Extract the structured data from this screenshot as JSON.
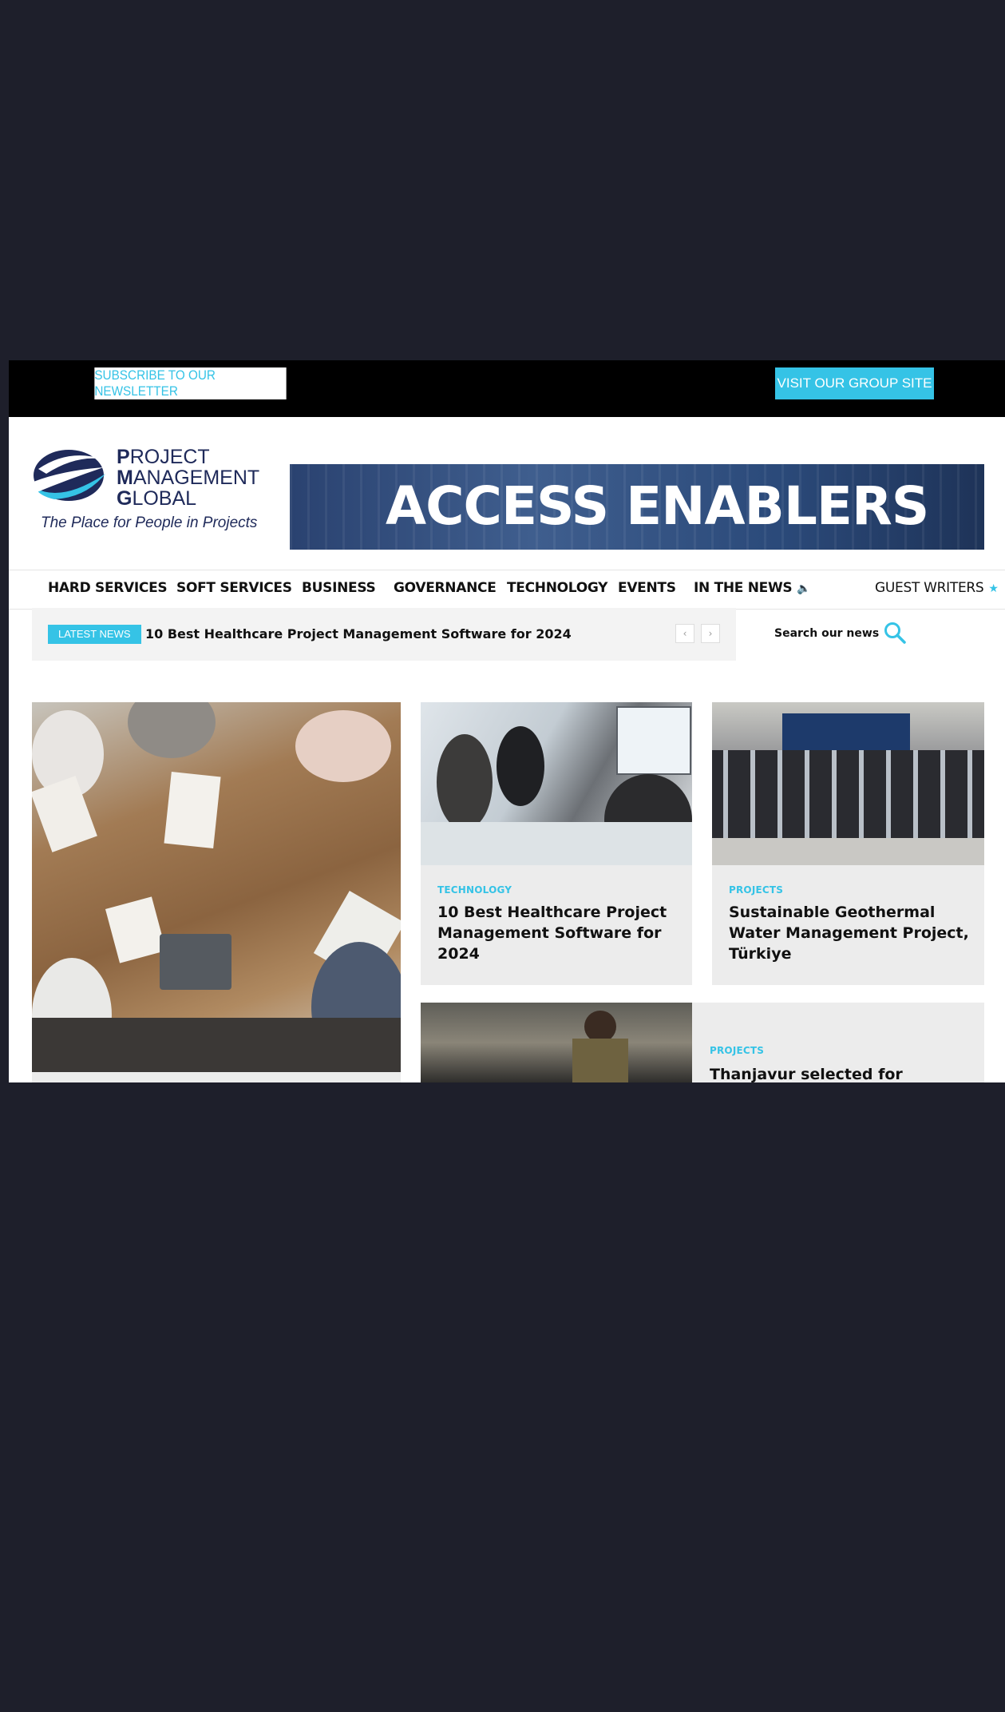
{
  "topbar": {
    "newsletter_label": "SUBSCRIBE TO OUR NEWSLETTER",
    "group_site_label": "VISIT OUR GROUP SITE"
  },
  "header": {
    "logo_line1_initial": "P",
    "logo_line1_rest": "ROJECT",
    "logo_line2_initial": "M",
    "logo_line2_rest": "ANAGEMENT",
    "logo_line3_initial": "G",
    "logo_line3_rest": "LOBAL",
    "tagline": "The Place for People in Projects",
    "banner_text": "ACCESS ENABLERS"
  },
  "nav": {
    "items": [
      "HARD SERVICES",
      "SOFT SERVICES",
      "BUSINESS",
      "GOVERNANCE",
      "TECHNOLOGY",
      "EVENTS",
      "IN THE NEWS"
    ],
    "guest_writers": "GUEST WRITERS"
  },
  "latest_news": {
    "badge": "LATEST NEWS",
    "headline": "10 Best Healthcare Project Management Software for 2024",
    "prev": "‹",
    "next": "›"
  },
  "search": {
    "label": "Search our news"
  },
  "cards": [
    {
      "category": "TECHNOLOGY",
      "title": "10 Best Healthcare Project Management Software for 2024"
    },
    {
      "category": "PROJECTS",
      "title": "Sustainable Geothermal Water Management Project, Türkiye"
    },
    {
      "category": "PROJECTS",
      "title": "Thanjavur selected for"
    }
  ],
  "colors": {
    "accent": "#35c3e6",
    "page_bg": "#1e1f2b",
    "brand_navy": "#1f2a5a",
    "card_bg": "#ececec"
  },
  "icons": {
    "search": "search-icon",
    "speaker": "speaker-icon",
    "star": "star-icon"
  }
}
